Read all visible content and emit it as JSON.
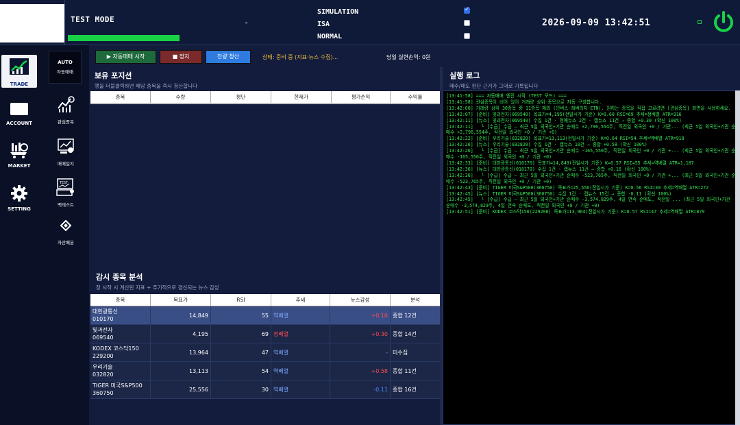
{
  "topbar": {
    "mode_label": "TEST MODE",
    "dash": "-",
    "modes": [
      {
        "label": "SIMULATION",
        "checked": true
      },
      {
        "label": "ISA",
        "checked": false
      },
      {
        "label": "NORMAL",
        "checked": false
      }
    ],
    "datetime": "2026-09-09 13:42:51"
  },
  "sidebar": {
    "nav": [
      {
        "label": "TRADE",
        "icon": "trade-chart-icon"
      },
      {
        "label": "ACCOUNT",
        "icon": "account-card-icon"
      },
      {
        "label": "MARKET",
        "icon": "market-cart-icon"
      },
      {
        "label": "SETTING",
        "icon": "gear-icon"
      }
    ],
    "sub": [
      {
        "top_label": "AUTO",
        "label": "자동매매"
      },
      {
        "label": "관심종목",
        "icon": "watchlist-chart-icon"
      },
      {
        "label": "매매일지",
        "icon": "journal-chart-icon"
      },
      {
        "label": "백테스트",
        "icon": "backtest-icon"
      },
      {
        "label": "자산배분",
        "icon": "diamond-icon"
      }
    ]
  },
  "toolbar": {
    "start_label": "▶ 자동매매 시작",
    "stop_label": "■ 정지",
    "liquidate_label": "잔량 청산",
    "status": "상태: 준비 중 (지표·뉴스 수집)...",
    "pnl": "당일 실현손익: 0원"
  },
  "positions": {
    "title": "보유 포지션",
    "subtitle": "행을 더블클릭하면 해당 종목을 즉시 청산합니다",
    "columns": [
      "종목",
      "수량",
      "평단",
      "현재가",
      "평가손익",
      "수익률"
    ]
  },
  "analysis": {
    "title": "감시 종목 분석",
    "subtitle": "장 시작 시 계산된 지표 + 주기적으로 갱신되는 뉴스 감성",
    "columns": [
      "종목",
      "목표가",
      "RSI",
      "추세",
      "뉴스감성",
      "분석"
    ],
    "rows": [
      {
        "name": "대한광통신",
        "code": "010170",
        "target": "14,849",
        "rsi": "55",
        "trend": "역배열",
        "sentiment": "+0.16",
        "analysis": "종합 12건"
      },
      {
        "name": "빛과전자",
        "code": "069540",
        "target": "4,195",
        "rsi": "69",
        "trend": "정배열",
        "sentiment": "+0.30",
        "analysis": "종합 14건"
      },
      {
        "name": "KODEX 코스닥150",
        "code": "229200",
        "target": "13,964",
        "rsi": "47",
        "trend": "역배열",
        "sentiment": "-",
        "analysis": "미수집"
      },
      {
        "name": "우리기술",
        "code": "032820",
        "target": "13,113",
        "rsi": "54",
        "trend": "역배열",
        "sentiment": "+0.58",
        "analysis": "종합 11건"
      },
      {
        "name": "TIGER 미국S&P500",
        "code": "360750",
        "target": "25,556",
        "rsi": "30",
        "trend": "역배열",
        "sentiment": "-0.11",
        "analysis": "종합 16건"
      }
    ]
  },
  "log": {
    "title": "실행 로그",
    "subtitle": "매수/매도 판단 근거가 그대로 기록됩니다",
    "lines": [
      "[13:41:58] === 자동매매 엔진 시작 (TEST 모드) ===",
      "[13:41:58] 관심종목이 비어 있어 거래량 상위 종목으로 자동 구성합니다.",
      "[13:42:00] 거래량 상위 30종목 중 11종목 제외 (인버스·레버리지·ETN). 원하는 종목을 직접 고르려면 [관심종목] 화면을 사용하세요.",
      "[13:42:07] [준비] 빛과전자(069540) 목표가=4,195(전일시가 기준) K=0.60 RSI=69 추세=정배열 ATR=316",
      "[13:42:11] [뉴스] 빛과전자(069540) 수집 1건 · 정해뉴스 2건 · 캡뉴스 11건 → 종합 +0.30 (확신 100%)",
      "[13:42:11]   └ [수급] 수급 — 최근 5일 외국인+기관 순매수 +2,796,554주, 직전일 외국인 +0 / 기관... (최근 5일 외국인+기관 순매수 +2,796,554주, 직전일 외국인 +0 / 기관 +0)",
      "[13:42:22] [준비] 우리기술(032820) 목표가=13,113(전일시가 기준) K=0.64 RSI=54 추세=역배열 ATR=918",
      "[13:42:26] [뉴스] 우리기술(032820) 수집 1건 · 캡뉴스 10건 → 종합 +0.58 (확신 100%)",
      "[13:42:26]   └ [수급] 수급 — 최근 5일 외국인+기관 순매수 -165,550주, 직전일 외국인 +0 / 기관 +... (최근 5일 외국인+기관 순매수 -165,550주, 직전일 외국인 +0 / 기관 +0)",
      "[13:42:33] [준비] 대한광통신(010170) 목표가=14,849(전일시가 기준) K=0.57 RSI=55 추세=역배열 ATR=1,187",
      "[13:42:36] [뉴스] 대한광통신(010170) 수집 1건 · 캡뉴스 11건 → 종합 +0.16 (확신 100%)",
      "[13:42:36]   └ [수급] 수급 — 최근 5일 외국인+기관 순매수 -523,765주, 직전일 외국인 +0 / 기관 +... (최근 5일 외국인+기관 순매수 -523,765주, 직전일 외국인 +0 / 기관 +0)",
      "[13:42:43] [준비] TIGER 미국S&P500(360750) 목표가=25,556(전일시가 기준) K=0.56 RSI=30 추세=역배열 ATR=272",
      "[13:42:45] [뉴스] TIGER 미국S&P500(360750) 수집 1건 · 캡뉴스 15건 → 종합 -0.11 (확신 100%)",
      "[13:42:45]   └ [수급] 수급 — 최근 5일 외국인+기관 순매수 -3,574,829주, 4일 연속 순매도, 직전일 ... (최근 5일 외국인+기관 순매수 -3,574,829주, 4일 연속 순매도, 직전일 외국인 +0 / 기관 +0)",
      "[13:42:51] [준비] KODEX 코스닥150(229200) 목표가=13,964(전일시가 기준) K=0.57 RSI=47 추세=역배열 ATR=879"
    ]
  },
  "colors": {
    "green": "#19d146",
    "status_yellow": "#f0c040",
    "positive": "#ff4d4d",
    "negative": "#4d8cff",
    "log_green": "#39e85a"
  }
}
